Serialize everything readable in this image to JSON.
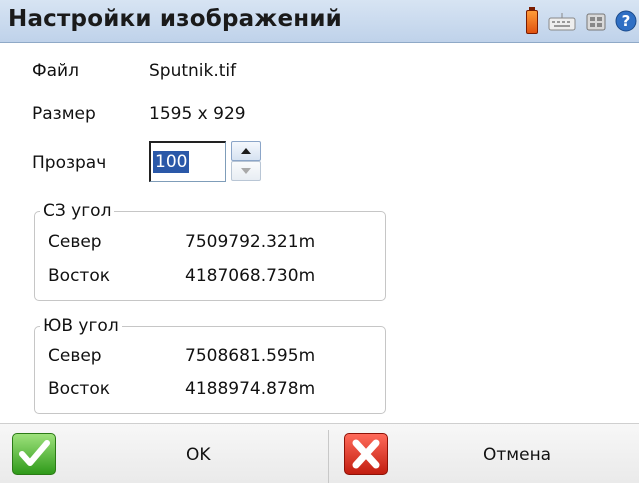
{
  "window": {
    "title": "Настройки изображений"
  },
  "tray": {
    "icons": [
      "battery-icon",
      "keyboard-icon",
      "input-panel-icon",
      "help-icon"
    ],
    "battery_color": "#f07020"
  },
  "fields": {
    "file_label": "Файл",
    "file_value": "Sputnik.tif",
    "size_label": "Размер",
    "size_value": "1595 x 929",
    "transparency_label": "Прозрач",
    "transparency_value": "100"
  },
  "nw_corner": {
    "caption": "СЗ угол",
    "north_label": "Север",
    "north_value": "7509792.321m",
    "east_label": "Восток",
    "east_value": "4187068.730m"
  },
  "se_corner": {
    "caption": "ЮВ угол",
    "north_label": "Север",
    "north_value": "7508681.595m",
    "east_label": "Восток",
    "east_value": "4188974.878m"
  },
  "footer": {
    "ok_label": "OK",
    "cancel_label": "Отмена",
    "ok_color": "#3aa828",
    "cancel_color": "#d8281a"
  }
}
